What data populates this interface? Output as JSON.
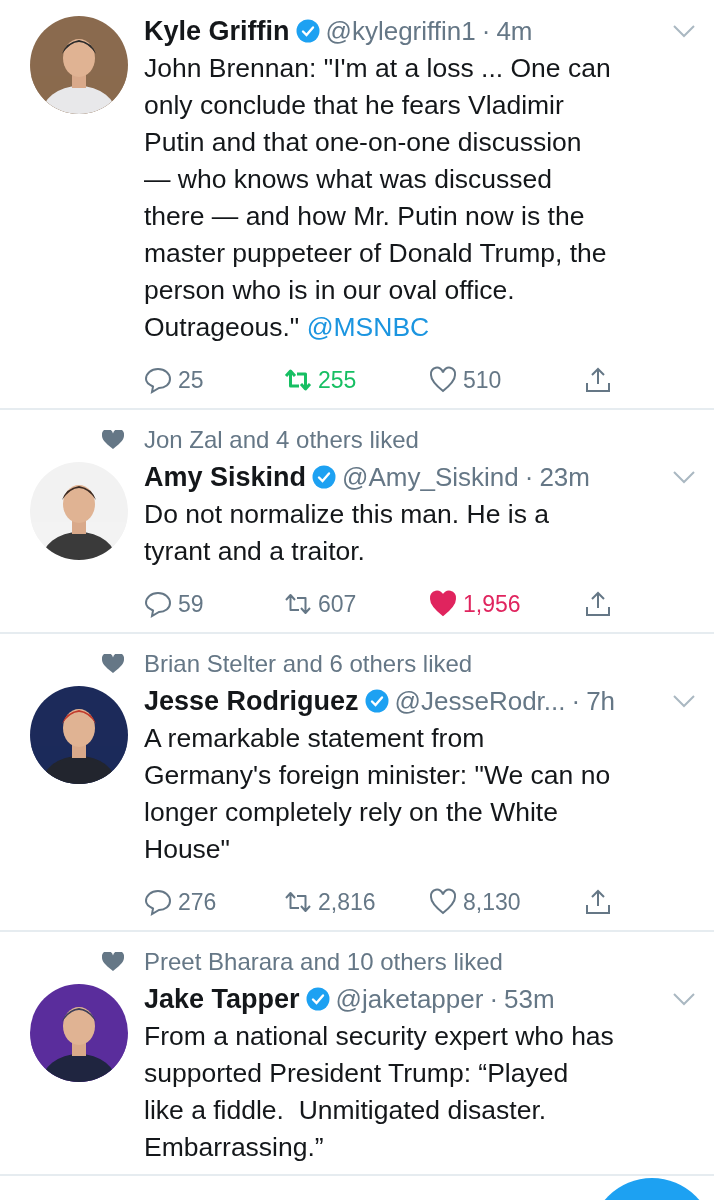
{
  "tweets": [
    {
      "name": "Kyle Griffin",
      "verified": true,
      "handle": "@kylegriffin1",
      "dot": "·",
      "time": "4m",
      "lines": [
        "John Brennan: \"I'm at a loss ... One can",
        "only conclude that he fears Vladimir",
        "Putin and that one-on-one discussion",
        "— who knows what was discussed",
        "there — and how Mr. Putin now is the",
        "master puppeteer of Donald Trump, the",
        "person who is in our oval office.",
        "Outrageous.\""
      ],
      "link": "@MSNBC",
      "actions": {
        "replies": "25",
        "retweets": "255",
        "likes": "510",
        "retweeted": true,
        "liked": false
      }
    },
    {
      "liked_by": "Jon Zal and 4 others liked",
      "name": "Amy Siskind",
      "verified": true,
      "handle": "@Amy_Siskind",
      "dot": "·",
      "time": "23m",
      "lines": [
        "Do not normalize this man. He is a",
        "tyrant and a traitor."
      ],
      "actions": {
        "replies": "59",
        "retweets": "607",
        "likes": "1,956",
        "retweeted": false,
        "liked": true
      }
    },
    {
      "liked_by": "Brian Stelter and 6 others liked",
      "name": "Jesse Rodriguez",
      "verified": true,
      "handle": "@JesseRodr...",
      "dot": "·",
      "time": "7h",
      "lines": [
        "A remarkable statement from",
        "Germany's foreign minister: \"We can no",
        "longer completely rely on the White",
        "House\""
      ],
      "actions": {
        "replies": "276",
        "retweets": "2,816",
        "likes": "8,130",
        "retweeted": false,
        "liked": false
      }
    },
    {
      "liked_by": "Preet Bharara and 10 others liked",
      "name": "Jake Tapper",
      "verified": true,
      "handle": "@jaketapper",
      "dot": "·",
      "time": "53m",
      "lines": [
        "From a national security expert who has",
        "supported President Trump: “Played",
        "like a fiddle.  Unmitigated disaster.",
        "Embarrassing.”"
      ]
    }
  ]
}
